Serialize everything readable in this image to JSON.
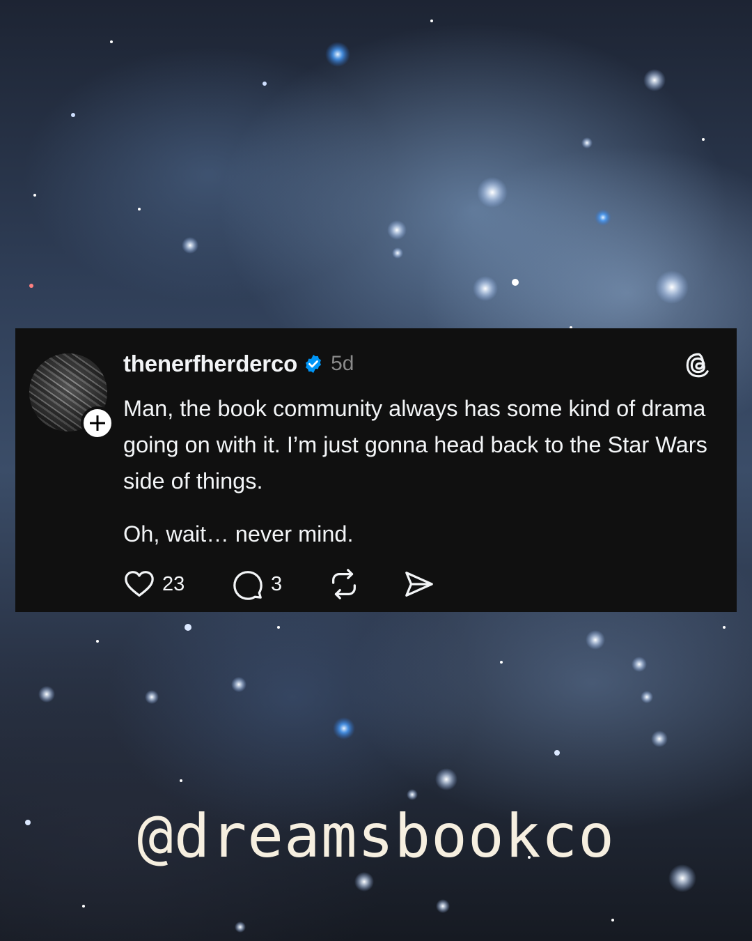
{
  "post": {
    "username": "thenerfherderco",
    "time": "5d",
    "body": [
      "Man, the book community always has some kind of drama going on with it. I’m just gonna head back to the Star Wars side of things.",
      "Oh, wait… never mind."
    ],
    "actions": {
      "likes": "23",
      "replies": "3"
    },
    "icons": {
      "verified": "verified-badge-icon",
      "platform": "threads-logo-icon",
      "like": "heart-icon",
      "reply": "speech-bubble-icon",
      "repost": "repost-icon",
      "share": "paper-plane-icon",
      "follow": "plus-icon"
    },
    "colors": {
      "card": "#101010",
      "text": "#f3f5f7",
      "muted": "#8a8a8a",
      "verified": "#0095f6"
    }
  },
  "watermark": "@dreamsbookco"
}
